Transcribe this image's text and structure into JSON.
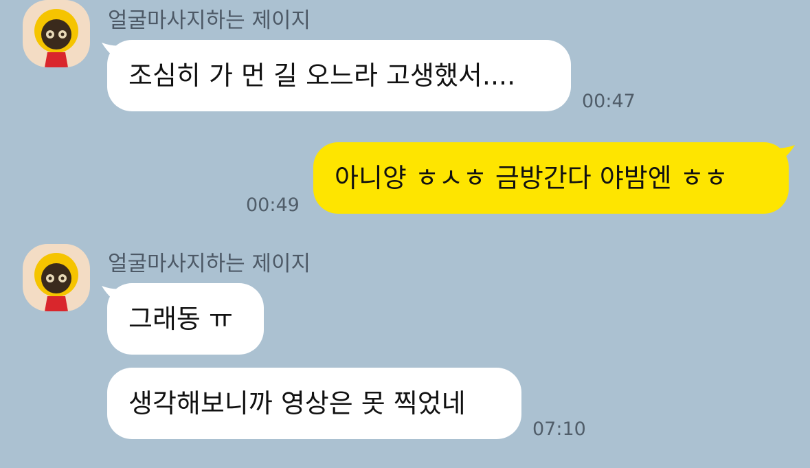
{
  "colors": {
    "background": "#abc1d1",
    "incoming_bubble": "#ffffff",
    "outgoing_bubble": "#fee500",
    "avatar_bg": "#f3dcc4"
  },
  "messages": [
    {
      "sender": "얼굴마사지하는 제이지",
      "avatar_icon": "character-avatar-icon",
      "text": "조심히 가 먼 길 오느라 고생했서....",
      "time": "00:47",
      "direction": "incoming"
    },
    {
      "text": "아니양 ㅎㅅㅎ 금방간다 야밤엔 ㅎㅎ",
      "time": "00:49",
      "direction": "outgoing"
    },
    {
      "sender": "얼굴마사지하는 제이지",
      "avatar_icon": "character-avatar-icon",
      "text": "그래동 ㅠ",
      "direction": "incoming"
    },
    {
      "text": "생각해보니까 영상은 못 찍었네",
      "time": "07:10",
      "direction": "incoming"
    }
  ]
}
